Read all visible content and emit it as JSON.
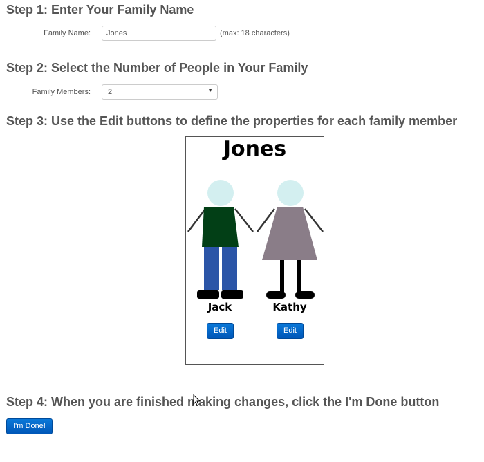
{
  "steps": {
    "step1": "Step 1: Enter Your Family Name",
    "step2": "Step 2: Select the Number of People in Your Family",
    "step3": "Step 3: Use the Edit buttons to define the properties for each family member",
    "step4": "Step 4: When you are finished making changes, click the I'm Done button"
  },
  "family_name_field": {
    "label": "Family Name:",
    "value": "Jones",
    "hint": "(max: 18 characters)"
  },
  "family_members_field": {
    "label": "Family Members:",
    "selected": "2"
  },
  "family_panel": {
    "title": "Jones",
    "members": [
      {
        "name": "Jack",
        "edit_label": "Edit",
        "shirt_color": "#023f16",
        "pants_color": "#2b55a7",
        "head_color": "#d3eff0"
      },
      {
        "name": "Kathy",
        "edit_label": "Edit",
        "dress_color": "#8a7d88",
        "head_color": "#d3eff0"
      }
    ]
  },
  "done_button": {
    "label": "I'm Done!"
  },
  "colors": {
    "heading": "#555555",
    "button_blue": "#0a67c9"
  },
  "icons": [
    "mouse-cursor-icon",
    "dropdown-caret-icon"
  ]
}
